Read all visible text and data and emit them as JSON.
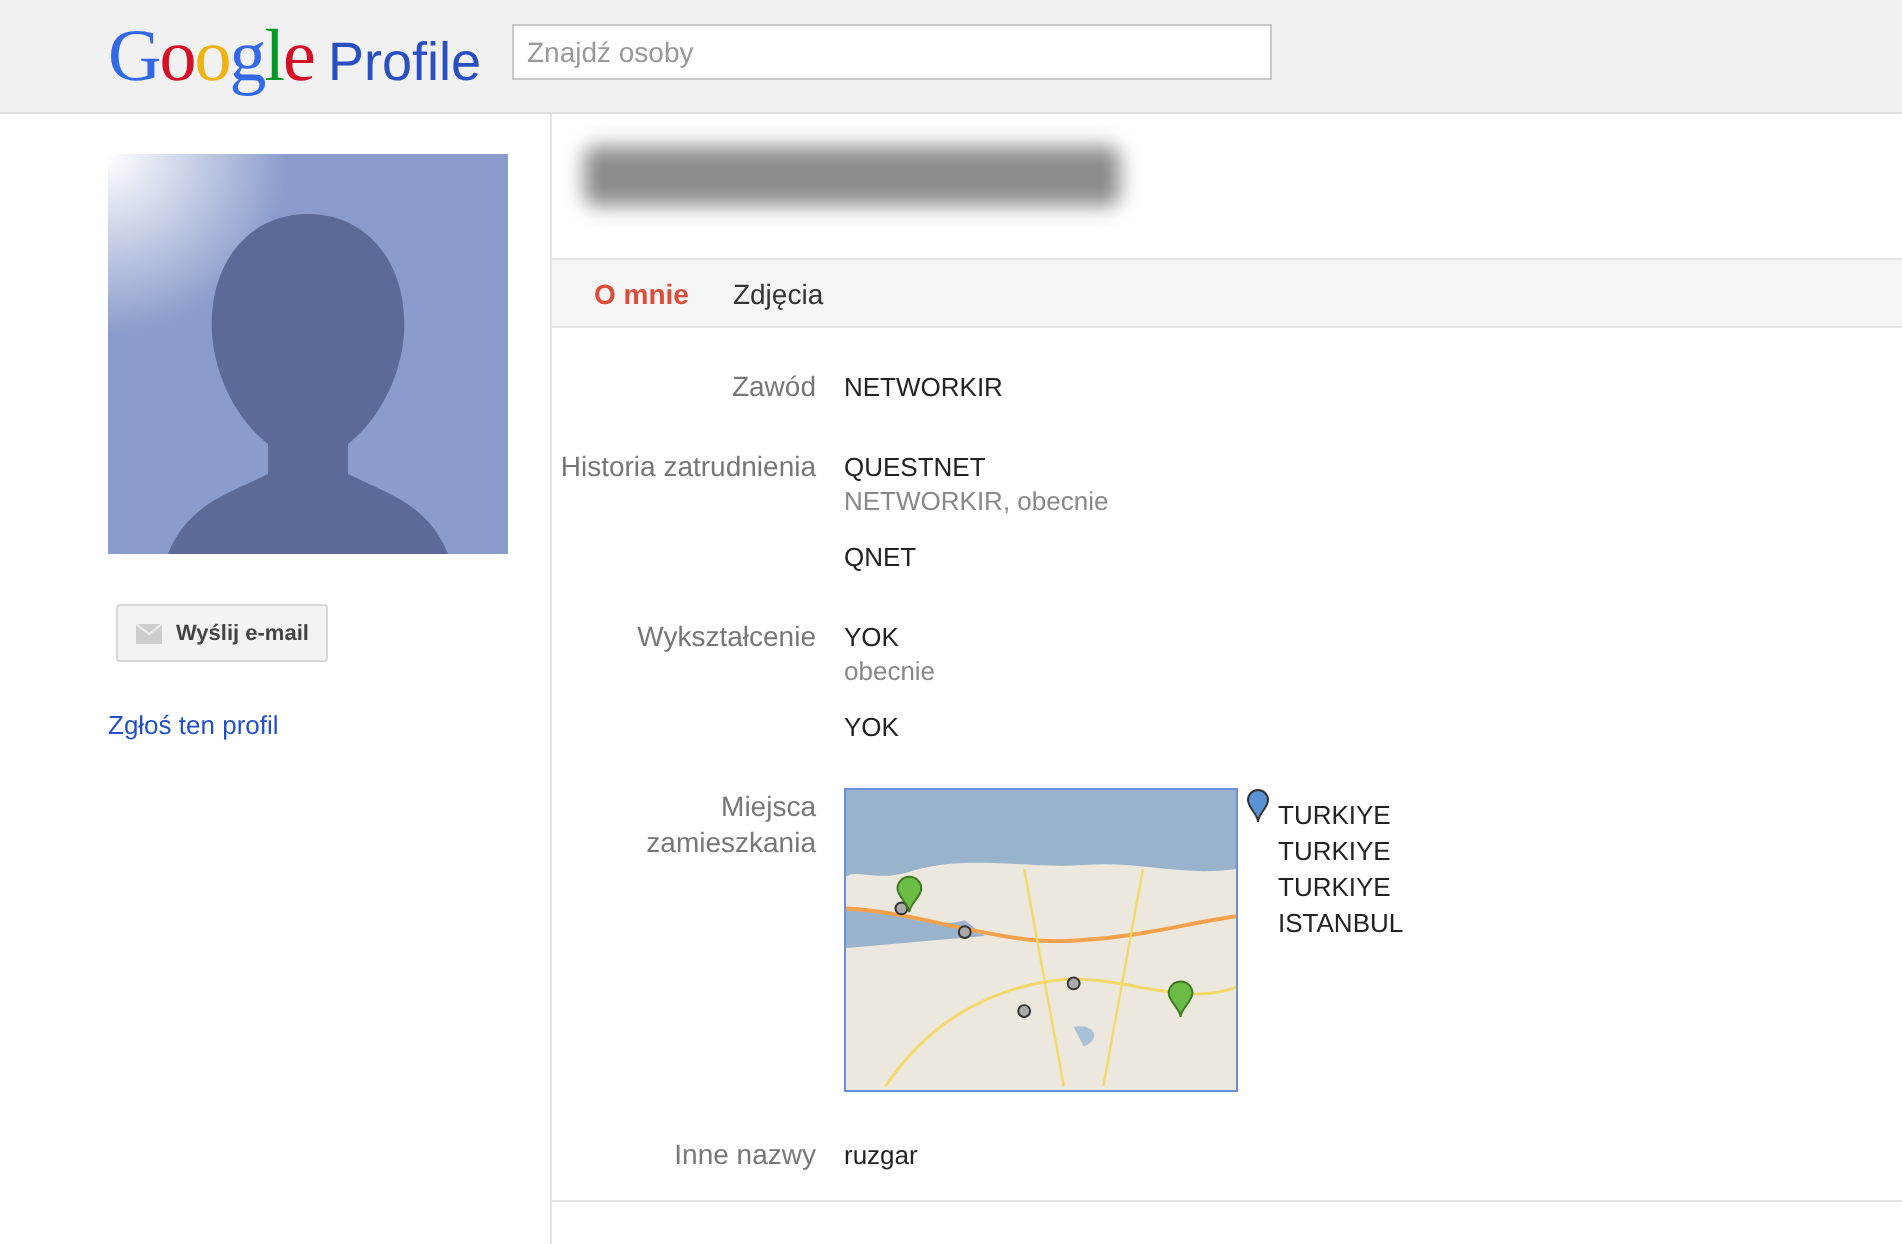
{
  "header": {
    "logo": {
      "word": "Google",
      "product": "Profile"
    },
    "search": {
      "placeholder": "Znajdź osoby"
    }
  },
  "sidebar": {
    "email_button": "Wyślij e-mail",
    "report_link": "Zgłoś ten profil"
  },
  "tabs": [
    {
      "label": "O mnie",
      "selected": true
    },
    {
      "label": "Zdjęcia",
      "selected": false
    }
  ],
  "fields": [
    {
      "kind": "entries",
      "label": "Zawód",
      "entries": [
        {
          "main": "NETWORKIR"
        }
      ]
    },
    {
      "kind": "entries",
      "label": "Historia zatrudnienia",
      "entries": [
        {
          "main": "QUESTNET",
          "sub": "NETWORKIR, obecnie"
        },
        {
          "main": "QNET"
        }
      ]
    },
    {
      "kind": "entries",
      "label": "Wykształcenie",
      "entries": [
        {
          "main": "YOK",
          "sub": "obecnie"
        },
        {
          "main": "YOK"
        }
      ]
    },
    {
      "kind": "map",
      "label": "Miejsca zamieszkania",
      "places": [
        "TURKIYE",
        "TURKIYE",
        "TURKIYE",
        "ISTANBUL"
      ]
    },
    {
      "kind": "entries",
      "label": "Inne nazwy",
      "entries": [
        {
          "main": "ruzgar"
        }
      ]
    }
  ]
}
